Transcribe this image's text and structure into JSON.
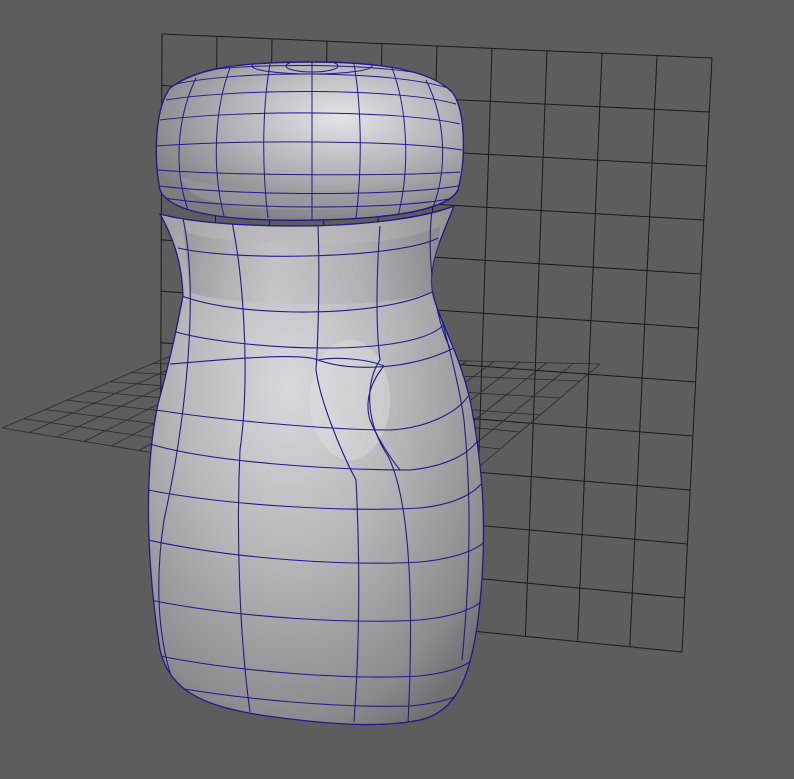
{
  "viewport": {
    "background": "#5d5d5d",
    "wire_color": "#1c1c8a",
    "grid_color": "#1a1a1a",
    "grid_divisions": {
      "back_plane": [
        10,
        11
      ],
      "ground_plane": [
        16,
        8
      ]
    }
  },
  "scene": {
    "object": "bottle-mesh",
    "display_mode": "smooth-shaded-with-wireframe",
    "selected": true
  }
}
